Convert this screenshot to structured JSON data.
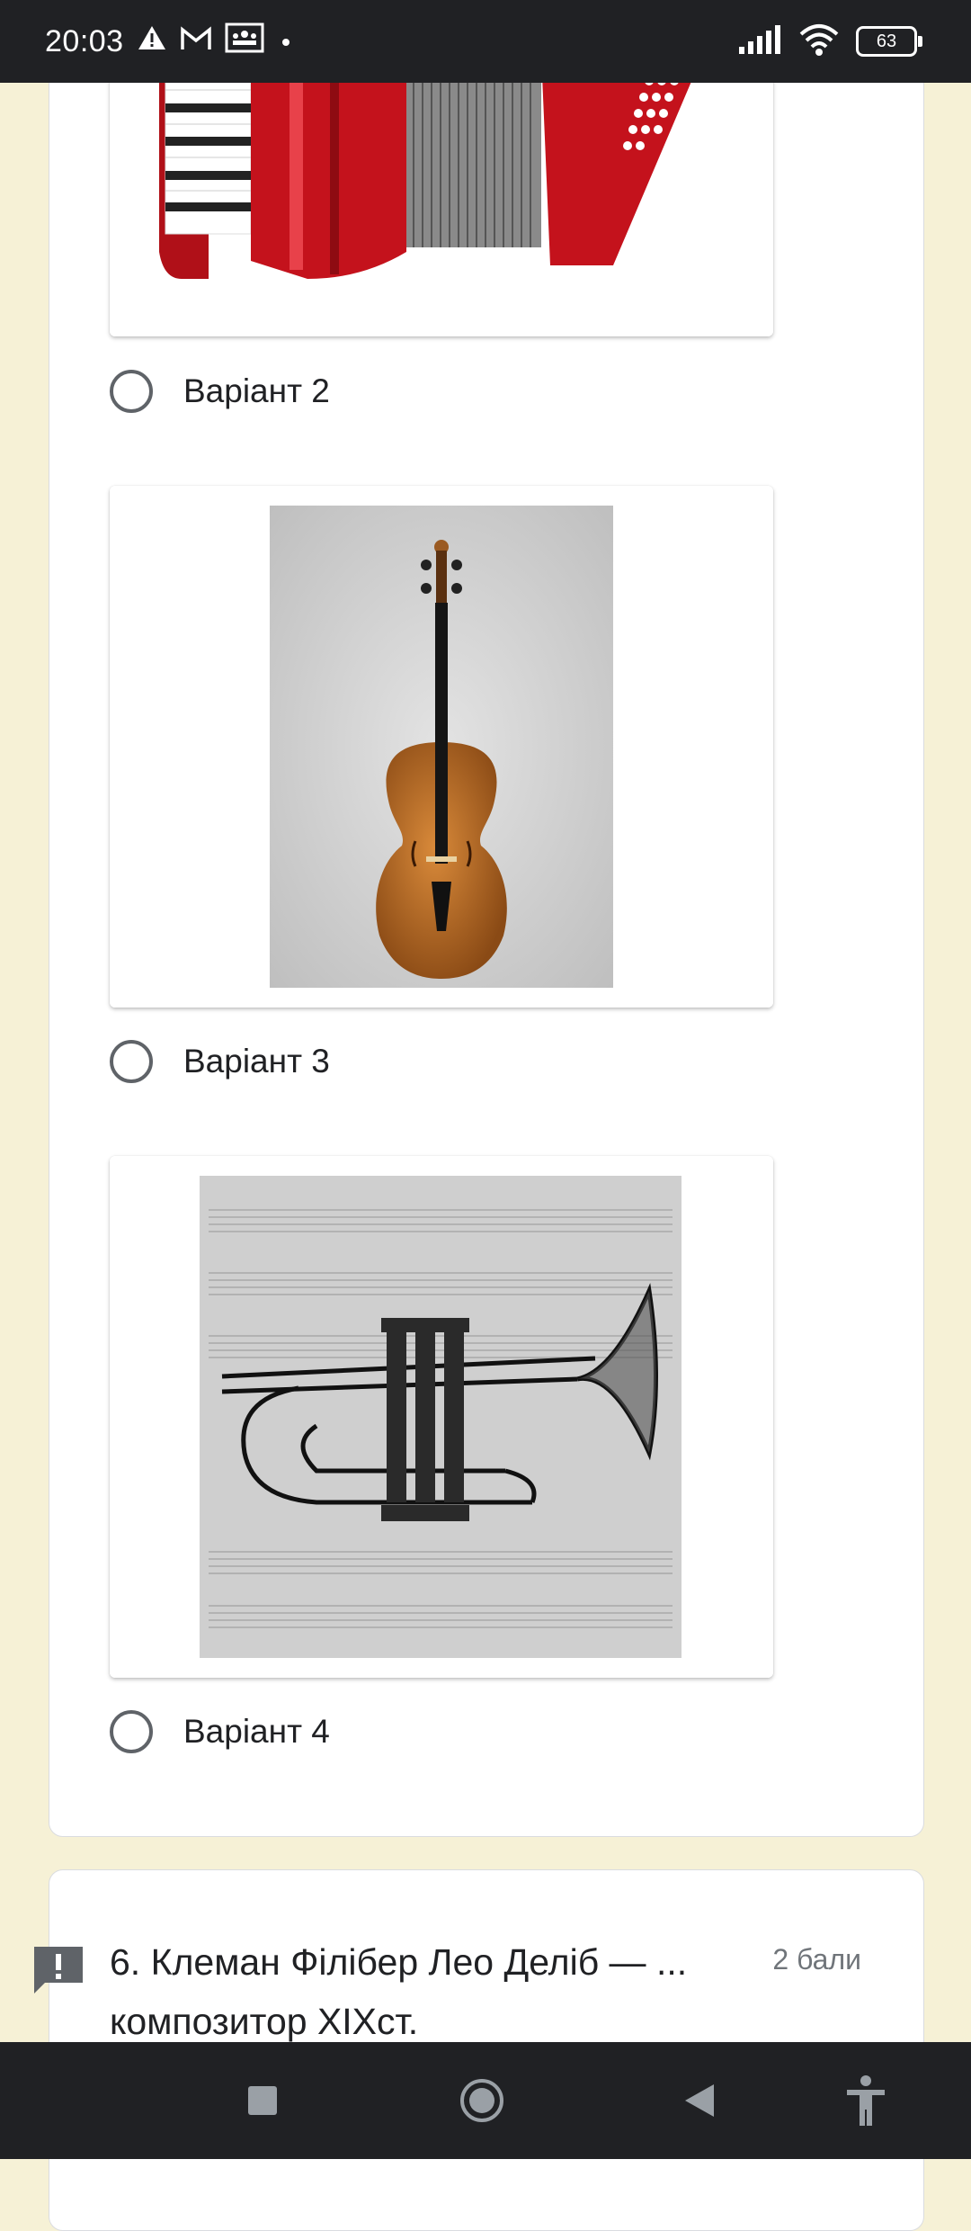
{
  "status_bar": {
    "time": "20:03",
    "battery": "63",
    "icons": [
      "warning-icon",
      "gmail-icon",
      "classroom-icon",
      "dot-icon",
      "signal-icon",
      "wifi-icon",
      "battery-icon"
    ]
  },
  "question5": {
    "options": [
      {
        "label": "Варіант 2",
        "image": "accordion"
      },
      {
        "label": "Варіант 3",
        "image": "violin"
      },
      {
        "label": "Варіант 4",
        "image": "cornet"
      }
    ]
  },
  "question6": {
    "title_line1": "6. Клеман Філібер Лео Деліб — ...",
    "title_line2": "композитор XIXст.",
    "points": "2 бали"
  },
  "nav_bar": {
    "icons": [
      "recents-icon",
      "home-icon",
      "back-icon",
      "accessibility-icon"
    ]
  },
  "colors": {
    "background": "#f6f1d6",
    "status_bar": "#202124",
    "radio_border": "#5f6368",
    "text_primary": "#202124",
    "text_secondary": "#70757a"
  }
}
